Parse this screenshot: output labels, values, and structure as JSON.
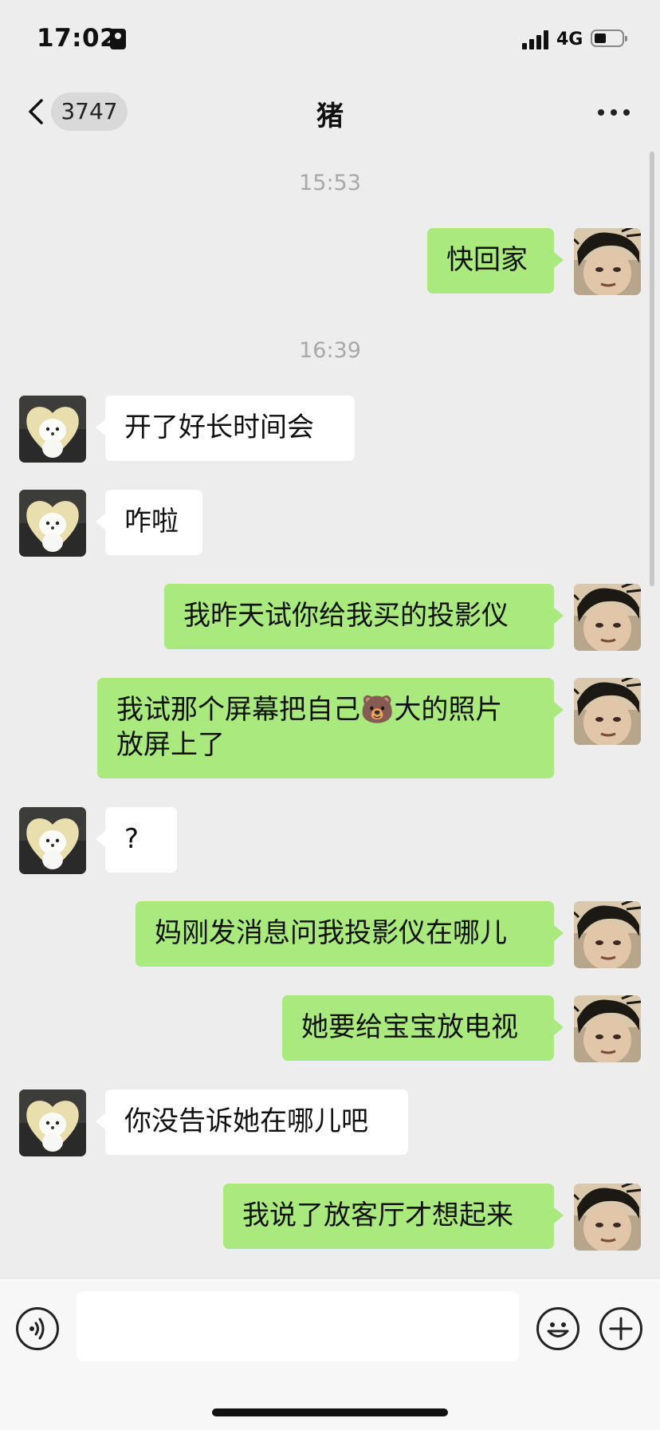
{
  "status_bar": {
    "time": "17:02",
    "network": "4G"
  },
  "nav": {
    "back_badge": "3747",
    "title": "猪"
  },
  "messages": [
    {
      "type": "timestamp",
      "text": "15:53"
    },
    {
      "from": "me",
      "text": "快回家"
    },
    {
      "type": "timestamp",
      "text": "16:39"
    },
    {
      "from": "other",
      "text": "开了好长时间会"
    },
    {
      "from": "other",
      "text": "咋啦"
    },
    {
      "from": "me",
      "text": "我昨天试你给我买的投影仪"
    },
    {
      "from": "me",
      "line1": "我试那个屏幕把自己🐻大的照片",
      "line2": "放屏上了"
    },
    {
      "from": "other",
      "text": "?"
    },
    {
      "from": "me",
      "text": "妈刚发消息问我投影仪在哪儿"
    },
    {
      "from": "me",
      "text": "她要给宝宝放电视"
    },
    {
      "from": "other",
      "text": "你没告诉她在哪儿吧"
    },
    {
      "from": "me",
      "text": "我说了放客厅才想起来"
    }
  ],
  "input": {
    "placeholder": ""
  },
  "icons": {
    "back": "chevron-left-icon",
    "more": "more-dots-icon",
    "voice": "voice-icon",
    "emoji": "emoji-icon",
    "plus": "plus-icon"
  },
  "colors": {
    "my_bubble": "#a9e97d",
    "other_bubble": "#ffffff",
    "background": "#ededed"
  }
}
